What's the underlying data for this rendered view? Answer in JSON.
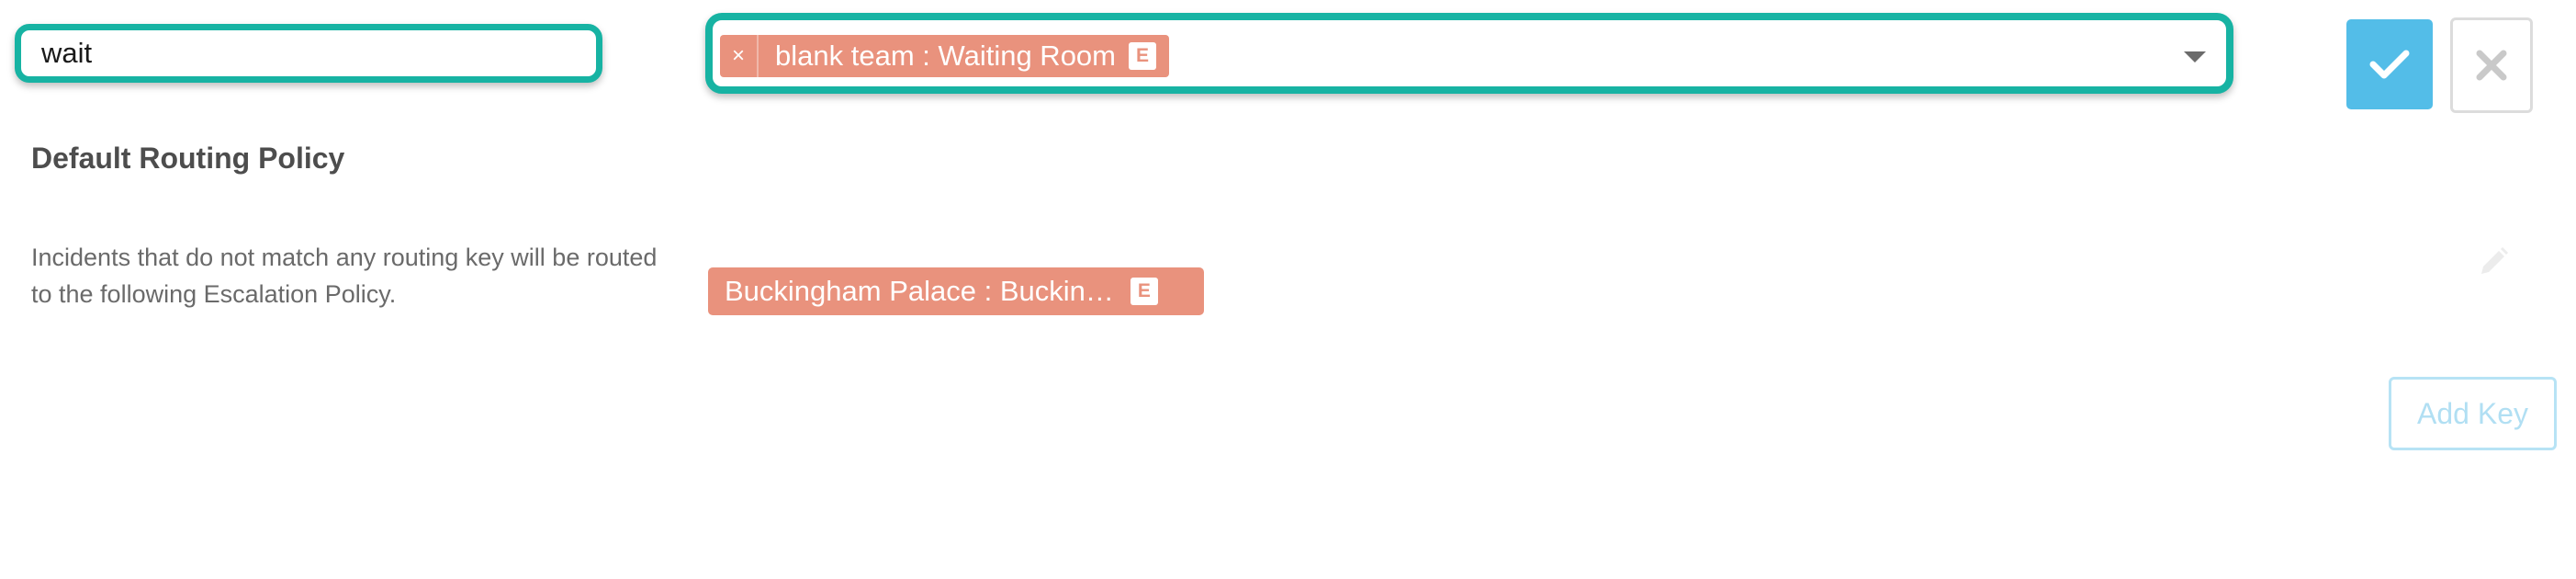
{
  "edit_row": {
    "routing_key_value": "wait",
    "selected_policy": {
      "remove_symbol": "×",
      "label": "blank team : Waiting Room",
      "badge": "E"
    }
  },
  "default_policy": {
    "title": "Default Routing Policy",
    "description": "Incidents that do not match any routing key will be routed to the following Escalation Policy.",
    "policy_label": "Buckingham Palace : Buckin…",
    "policy_badge": "E"
  },
  "actions": {
    "add_key_label": "Add Key"
  },
  "icons": {
    "confirm": "checkmark-icon",
    "cancel": "close-icon",
    "dropdown": "chevron-down-icon",
    "edit": "pencil-icon"
  },
  "colors": {
    "accent_teal": "#17b3a3",
    "tag_salmon": "#e9927d",
    "confirm_blue": "#53bde8",
    "add_key_border": "#b7e3f5",
    "title_text": "#4d4d4d",
    "desc_text": "#6a6a6a"
  }
}
